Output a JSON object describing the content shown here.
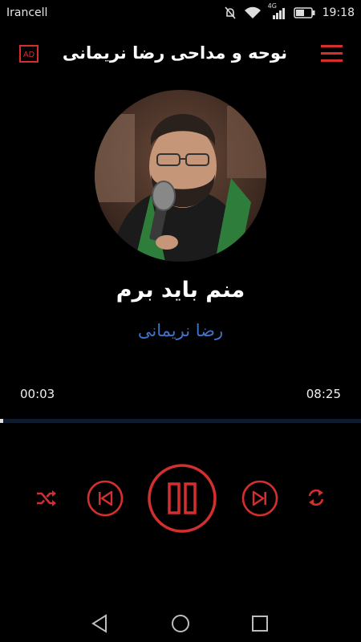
{
  "status_bar": {
    "carrier": "Irancell",
    "network": "4G",
    "time": "19:18"
  },
  "header": {
    "title": "نوحه و مداحی رضا نریمانی",
    "ad_label": "AD"
  },
  "player": {
    "track_title": "منم باید برم",
    "artist": "رضا نریمانی",
    "current_time": "00:03",
    "total_time": "08:25",
    "progress_fraction": 0.006,
    "is_playing": true
  },
  "icons": {
    "menu": "hamburger-menu-icon",
    "ad": "ad-icon",
    "shuffle": "shuffle-icon",
    "previous": "skip-previous-icon",
    "pause": "pause-icon",
    "next": "skip-next-icon",
    "repeat": "repeat-icon",
    "nav_back": "back-triangle-icon",
    "nav_home": "home-circle-icon",
    "nav_recents": "recents-square-icon"
  },
  "colors": {
    "accent": "#d32f2f",
    "artist_text": "#3f73c8",
    "background": "#000000",
    "progress_track": "#0e1a2e"
  }
}
